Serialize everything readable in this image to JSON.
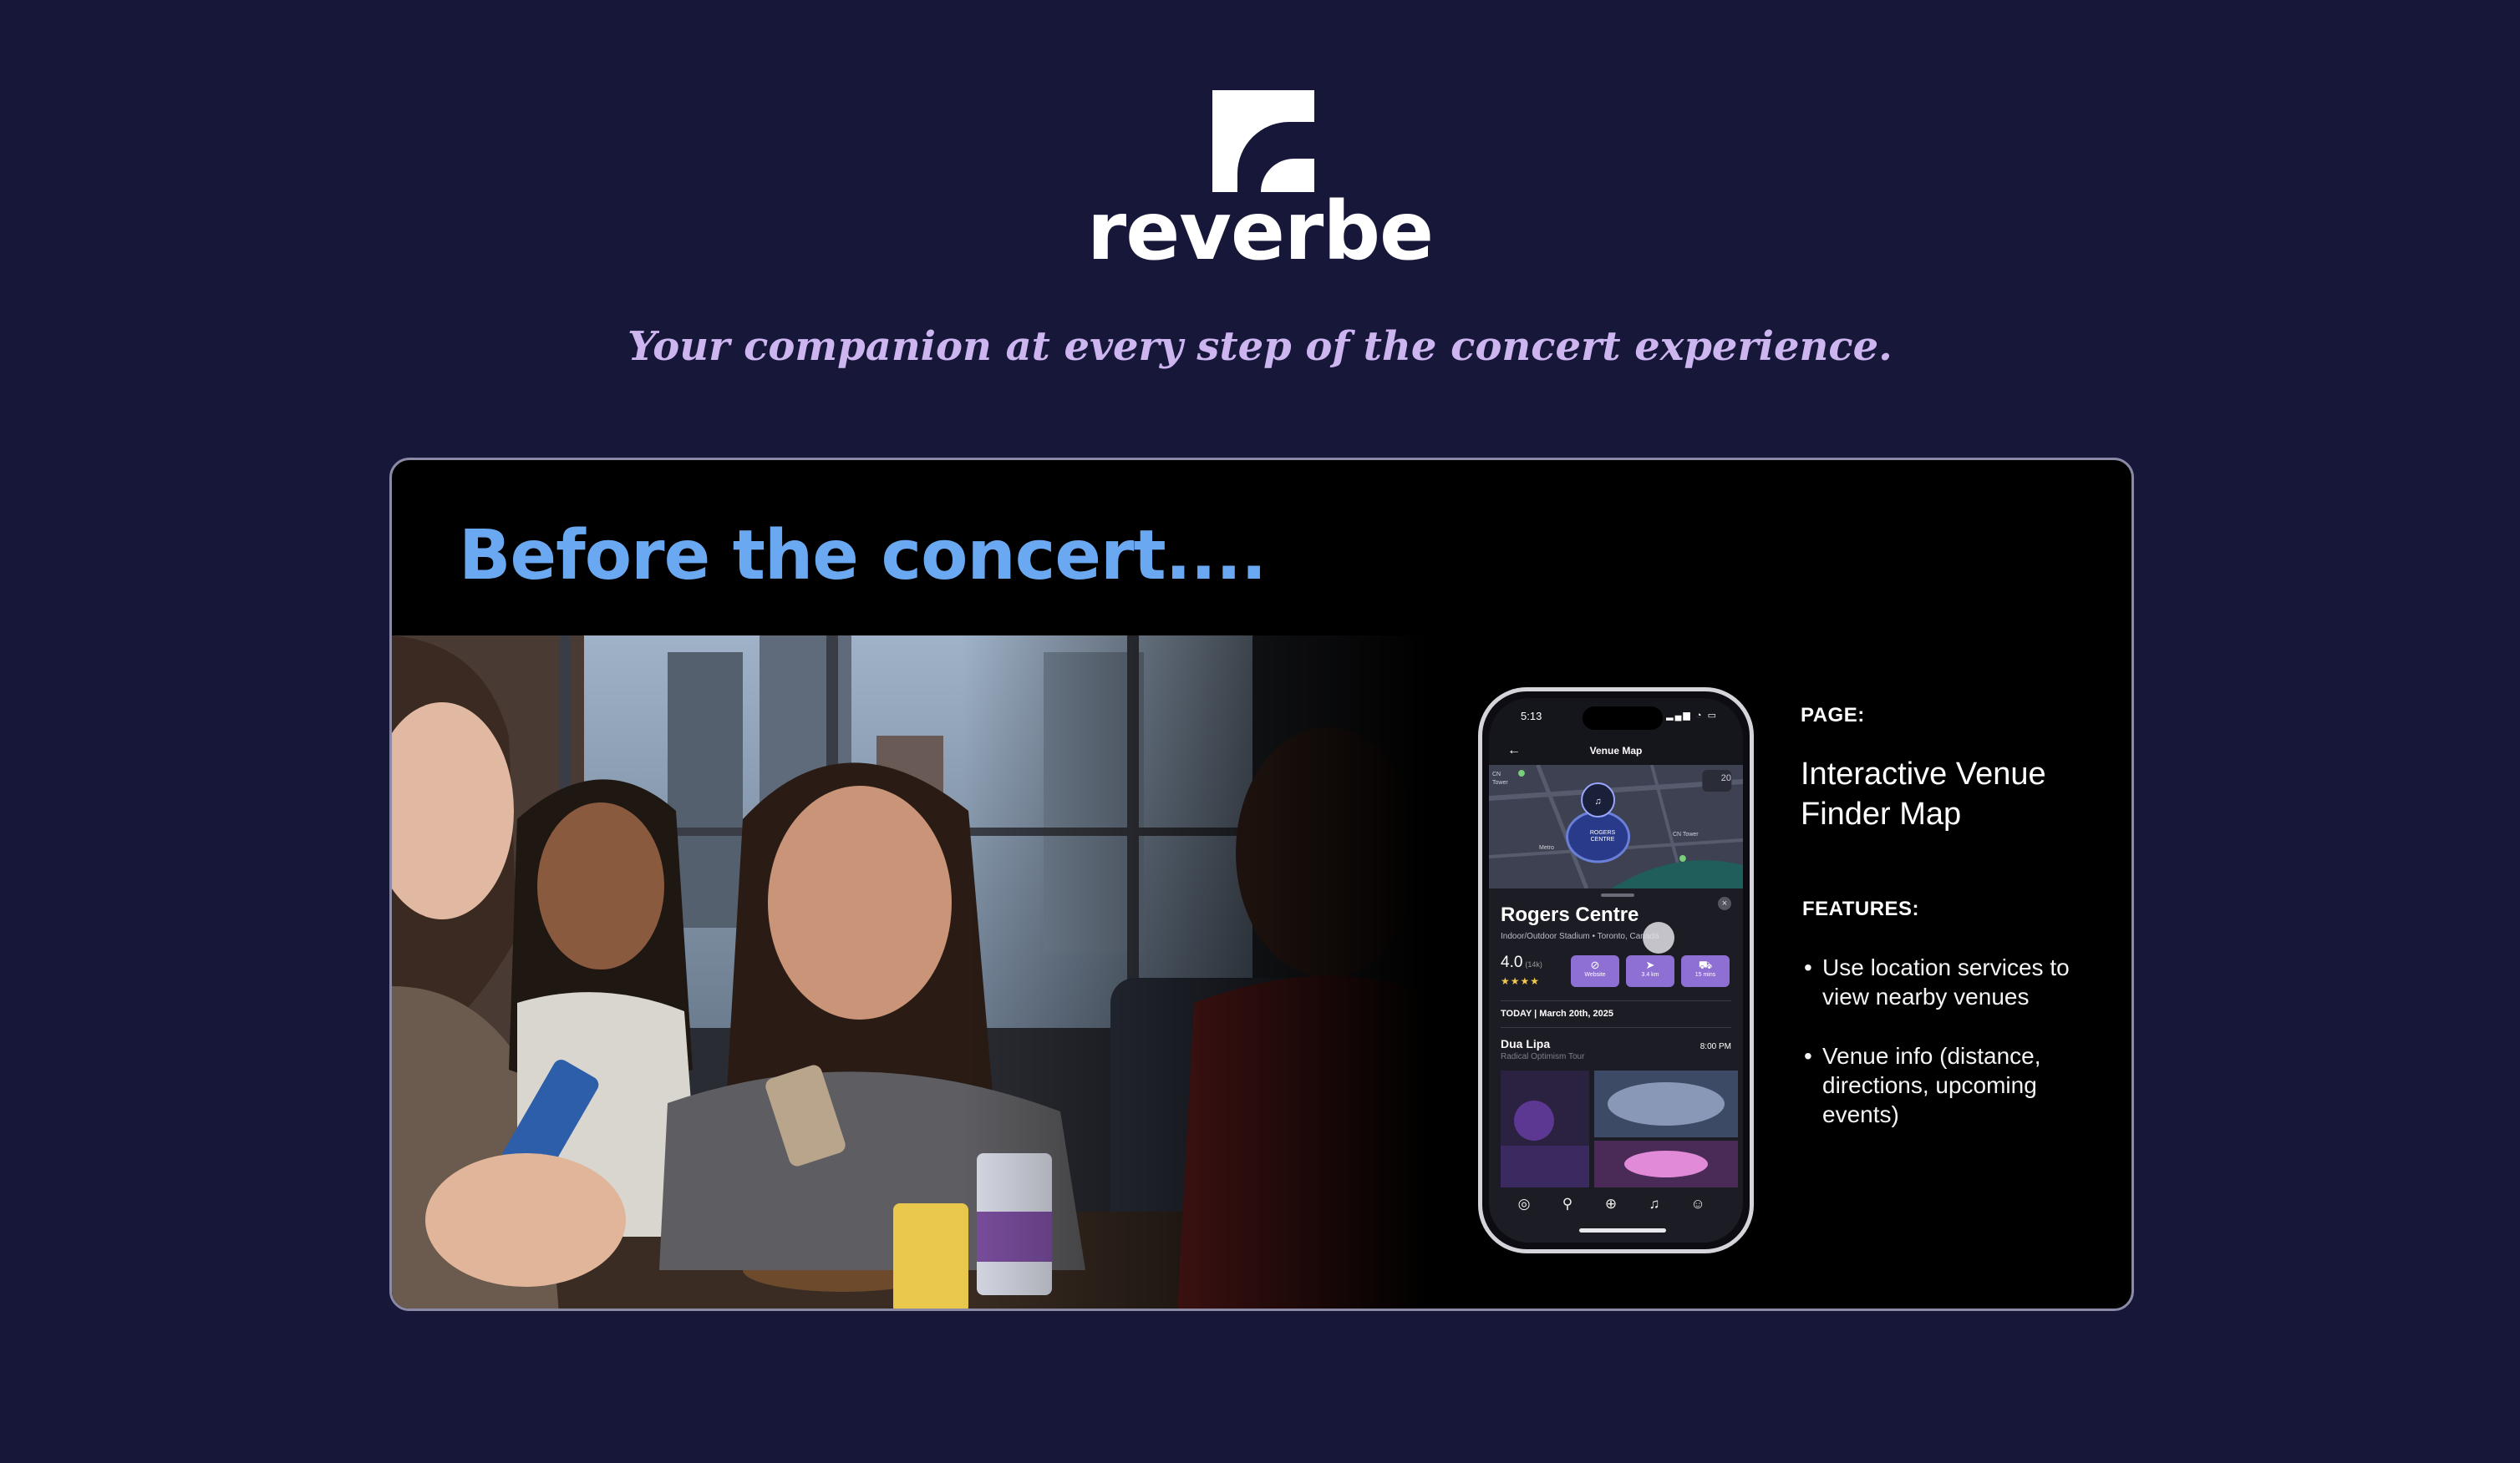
{
  "brand": {
    "name": "reverbe",
    "tagline": "Your companion at every step of the concert experience.",
    "colors": {
      "background": "#17173a",
      "tagline": "#cdb6f0",
      "heading": "#6aa9f1",
      "accent": "#8e6fd3"
    }
  },
  "card": {
    "title": "Before the concert....",
    "photo_icon": "friends-with-phones-photo"
  },
  "phone": {
    "status": {
      "time": "5:13",
      "icons": "signal-wifi-battery-icons"
    },
    "nav": {
      "back_icon": "back-arrow-icon",
      "title": "Venue Map"
    },
    "map": {
      "venue_label": "ROGERS CENTRE",
      "zoom_badge": "20",
      "labels": [
        "CN",
        "Tower",
        "Metro",
        "CN Tower"
      ]
    },
    "venue": {
      "name": "Rogers Centre",
      "subtitle": "Indoor/Outdoor Stadium • Toronto, Canada",
      "rating": "4.0",
      "rating_count": "(14k)",
      "stars": "★★★★",
      "actions": [
        {
          "icon": "compass-icon",
          "glyph": "⊘",
          "label": "Website"
        },
        {
          "icon": "navigate-icon",
          "glyph": "➤",
          "label": "3.4 km"
        },
        {
          "icon": "car-icon",
          "glyph": "⛟",
          "label": "15 mins"
        }
      ]
    },
    "schedule": {
      "date": "TODAY | March 20th, 2025",
      "event": {
        "artist": "Dua Lipa",
        "tour": "Radical Optimism Tour",
        "time": "8:00 PM"
      }
    },
    "tabs": [
      {
        "icon": "globe-icon",
        "glyph": "🌐"
      },
      {
        "icon": "search-icon",
        "glyph": "⚲"
      },
      {
        "icon": "add-icon",
        "glyph": "⊕"
      },
      {
        "icon": "bell-icon",
        "glyph": "♫"
      },
      {
        "icon": "profile-icon",
        "glyph": "☺"
      }
    ]
  },
  "description": {
    "page_label": "PAGE:",
    "page_name": "Interactive Venue Finder Map",
    "features_label": "FEATURES:",
    "features": [
      "Use location services to view nearby venues",
      "Venue info (distance, directions, upcoming events)"
    ]
  }
}
